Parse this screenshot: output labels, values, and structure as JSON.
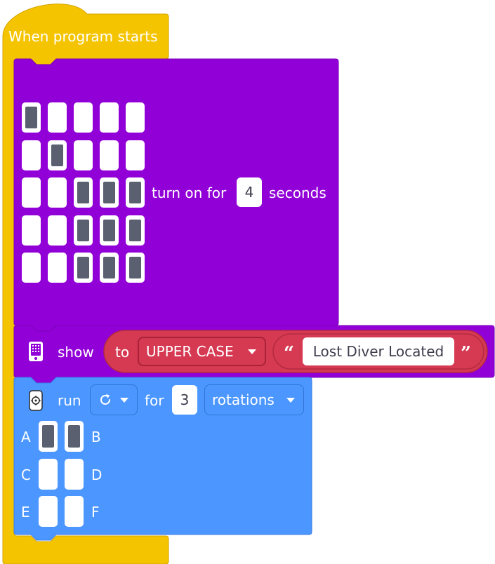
{
  "colors": {
    "events": "#f5c400",
    "events_border": "#d4a300",
    "display": "#9200d8",
    "display_border": "#7a00b8",
    "operator": "#d63a52",
    "operator_border": "#b42a40",
    "motor": "#4c97ff",
    "motor_border": "#3a7ee0",
    "pixel_on": "#5a6070",
    "pixel_off": "#ffffff"
  },
  "hat_block": {
    "label": "When program starts"
  },
  "light_matrix_block": {
    "label": "turn on for",
    "duration": "4",
    "unit": "seconds",
    "matrix": [
      [
        1,
        0,
        0,
        0,
        0
      ],
      [
        0,
        1,
        0,
        0,
        0
      ],
      [
        0,
        0,
        1,
        1,
        1
      ],
      [
        0,
        0,
        1,
        1,
        1
      ],
      [
        0,
        0,
        1,
        1,
        1
      ]
    ]
  },
  "show_block": {
    "icon": "light-matrix-icon",
    "label": "show",
    "operator": {
      "label": "to",
      "case_value": "UPPER CASE",
      "text": "Lost Diver Located",
      "open_quote": "“",
      "close_quote": "”"
    }
  },
  "motor_block": {
    "icon": "motor-icon",
    "label": "run",
    "direction_icon": "clockwise-icon",
    "for_label": "for",
    "amount": "3",
    "unit_value": "rotations",
    "ports": [
      {
        "left": "A",
        "right": "B",
        "left_on": true,
        "right_on": true
      },
      {
        "left": "C",
        "right": "D",
        "left_on": false,
        "right_on": false
      },
      {
        "left": "E",
        "right": "F",
        "left_on": false,
        "right_on": false
      }
    ]
  }
}
